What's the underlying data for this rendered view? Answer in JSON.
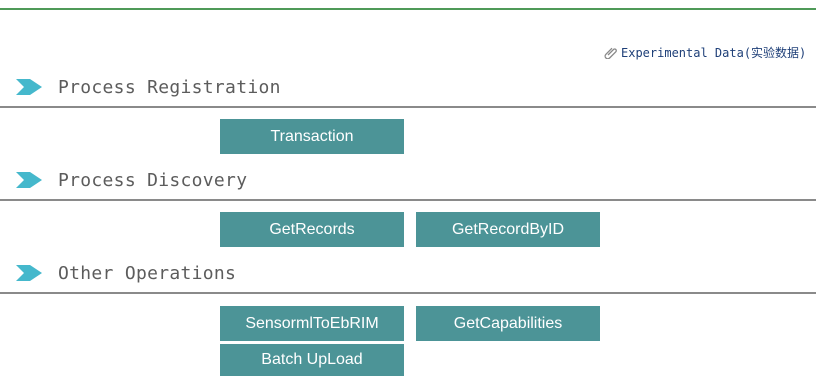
{
  "header": {
    "experimental_link_label": "Experimental Data(实验数据)",
    "link_color": "#1e3f78",
    "top_rule_color": "#4f9a58"
  },
  "sections": [
    {
      "title": "Process Registration",
      "buttons": [
        "Transaction"
      ]
    },
    {
      "title": "Process Discovery",
      "buttons": [
        "GetRecords",
        "GetRecordByID"
      ]
    },
    {
      "title": "Other Operations",
      "buttons": [
        "SensormlToEbRIM",
        "GetCapabilities",
        "Batch UpLoad"
      ]
    }
  ],
  "style": {
    "button_color": "#4c9497",
    "arrow_color": "#45b8cc",
    "rule_color": "#8a8a8a"
  }
}
